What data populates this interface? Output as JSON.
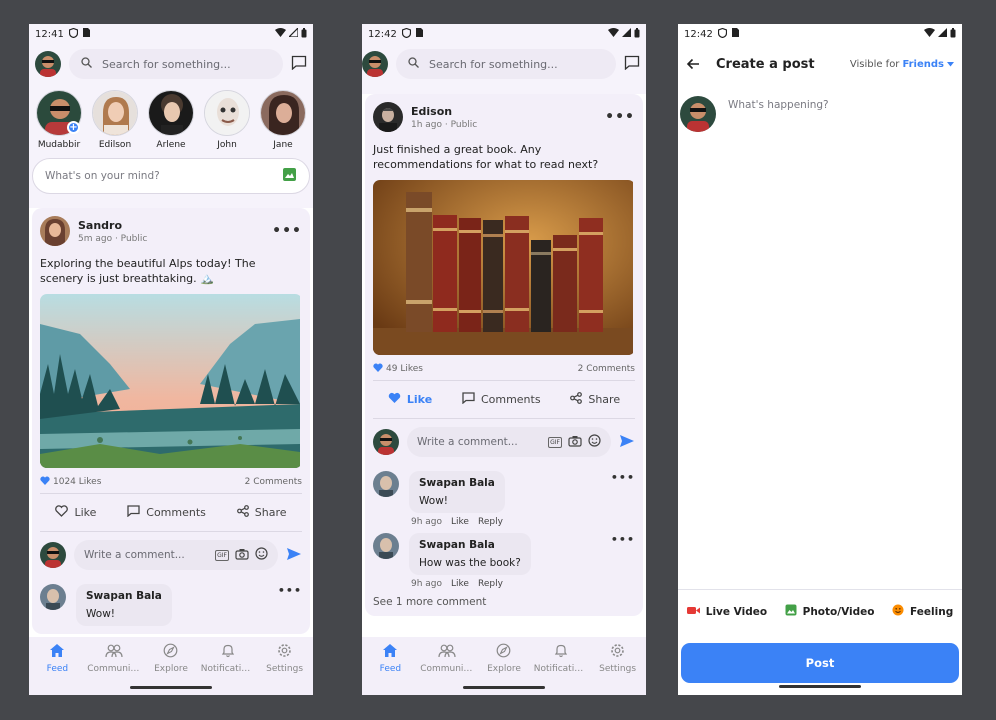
{
  "colors": {
    "accent": "#3b82f6",
    "background": "#45474b",
    "card": "#f3eff9"
  },
  "screen1": {
    "status": {
      "time": "12:41"
    },
    "search": {
      "placeholder": "Search for something..."
    },
    "stories": [
      {
        "name": "Mudabbir",
        "add": true
      },
      {
        "name": "Edilson"
      },
      {
        "name": "Arlene"
      },
      {
        "name": "John"
      },
      {
        "name": "Jane"
      }
    ],
    "composer": {
      "placeholder": "What's on your mind?"
    },
    "post": {
      "author": "Sandro",
      "meta": "5m ago · Public",
      "text": "Exploring the beautiful Alps today! The scenery is just breathtaking. 🏔️",
      "likes": "1024 Likes",
      "comments": "2 Comments",
      "actions": {
        "like": "Like",
        "comment": "Comments",
        "share": "Share"
      }
    },
    "comment_input": {
      "placeholder": "Write a comment..."
    },
    "comments": [
      {
        "author": "Swapan Bala",
        "text": "Wow!"
      }
    ]
  },
  "screen2": {
    "status": {
      "time": "12:42"
    },
    "search": {
      "placeholder": "Search for something..."
    },
    "post": {
      "author": "Edison",
      "meta": "1h ago · Public",
      "text": "Just finished a great book. Any recommendations for what to read next?",
      "likes": "49 Likes",
      "comments": "2 Comments",
      "actions": {
        "like": "Like",
        "comment": "Comments",
        "share": "Share"
      }
    },
    "comment_input": {
      "placeholder": "Write a comment..."
    },
    "comments": [
      {
        "author": "Swapan Bala",
        "text": "Wow!",
        "time": "9h ago",
        "like": "Like",
        "reply": "Reply"
      },
      {
        "author": "Swapan Bala",
        "text": "How was the book?",
        "time": "9h ago",
        "like": "Like",
        "reply": "Reply"
      }
    ],
    "see_more": "See 1 more comment"
  },
  "nav": [
    {
      "label": "Feed",
      "icon": "home-icon",
      "active": true
    },
    {
      "label": "Communities",
      "icon": "people-icon"
    },
    {
      "label": "Explore",
      "icon": "compass-icon"
    },
    {
      "label": "Notifications",
      "icon": "bell-icon"
    },
    {
      "label": "Settings",
      "icon": "gear-icon"
    }
  ],
  "screen3": {
    "status": {
      "time": "12:42"
    },
    "title": "Create a post",
    "visible_prefix": "Visible for",
    "visible_value": "Friends",
    "placeholder": "What's happening?",
    "tools": [
      {
        "label": "Live Video",
        "icon": "video-icon",
        "color": "#e53935"
      },
      {
        "label": "Photo/Video",
        "icon": "photo-icon",
        "color": "#43a047"
      },
      {
        "label": "Feeling",
        "icon": "smile-icon",
        "color": "#fb8c00"
      }
    ],
    "post_button": "Post"
  }
}
